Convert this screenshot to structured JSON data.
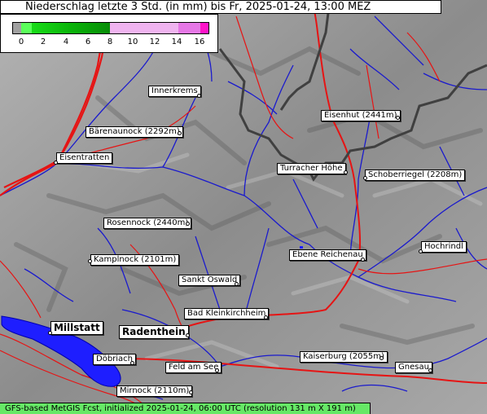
{
  "title": "Niederschlag letzte 3 Std. (in mm) bis Fr, 2025-01-24, 13:00 MEZ",
  "legend": {
    "ticks": [
      "0",
      "2",
      "4",
      "6",
      "8",
      "10",
      "12",
      "14",
      "16"
    ],
    "colors": {
      "below_zero": "#a0a0a0",
      "0-2": "#5aff5a",
      "2-4": "#19dc19",
      "4-6": "#0ab40a",
      "6-8": "#078c07",
      "8-14": "#f0b4f0",
      "14-16": "#e678e6",
      "above_16": "#ff14c8"
    }
  },
  "places": [
    {
      "name": "Innerkrems"
    },
    {
      "name": "Bärenaunock (2292m)"
    },
    {
      "name": "Eisentratten"
    },
    {
      "name": "Rosennock (2440m)"
    },
    {
      "name": "Kamplnock (2101m)"
    },
    {
      "name": "Sankt Oswald"
    },
    {
      "name": "Bad Kleinkirchheim"
    },
    {
      "name": "Millstatt"
    },
    {
      "name": "Radenthein"
    },
    {
      "name": "Döbriach"
    },
    {
      "name": "Feld am See"
    },
    {
      "name": "Mirnock (2110m)"
    },
    {
      "name": "Eisenhut (2441m)"
    },
    {
      "name": "Turracher Höhe"
    },
    {
      "name": "Schoberriegel (2208m)"
    },
    {
      "name": "Ebene Reichenau"
    },
    {
      "name": "Hochrindl"
    },
    {
      "name": "Kaiserburg (2055m)"
    },
    {
      "name": "Gnesau"
    }
  ],
  "map_colors": {
    "terrain": "#9a9a9a",
    "rivers": "#1a1acd",
    "roads": "#e61414",
    "border": "#404040",
    "lake": "#1e1eff"
  },
  "footer": "GFS-based MetGIS Fcst, initialized 2025-01-24, 06:00 UTC  (resolution 131 m X 191 m)"
}
